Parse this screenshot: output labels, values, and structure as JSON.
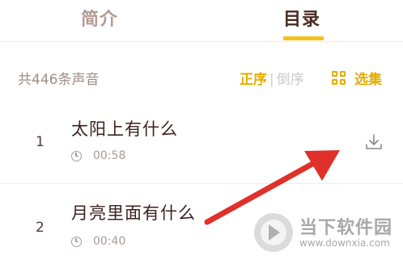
{
  "tabs": {
    "intro_label": "简介",
    "catalog_label": "目录",
    "active": "catalog"
  },
  "summary": {
    "count_text": "共446条声音",
    "order_asc": "正序",
    "order_separator": "|",
    "order_desc": "倒序",
    "select_label": "选集",
    "select_icon": "grid-icon"
  },
  "tracks": [
    {
      "number": "1",
      "title": "太阳上有什么",
      "duration": "00:58",
      "download_icon": "download-icon"
    },
    {
      "number": "2",
      "title": "月亮里面有什么",
      "duration": "00:40"
    }
  ],
  "watermark": {
    "name": "当下软件园",
    "url": "www.downxia.com"
  },
  "colors": {
    "accent": "#f2c21a",
    "accent_text": "#e6ad00",
    "annotation_arrow": "#e0302a"
  }
}
